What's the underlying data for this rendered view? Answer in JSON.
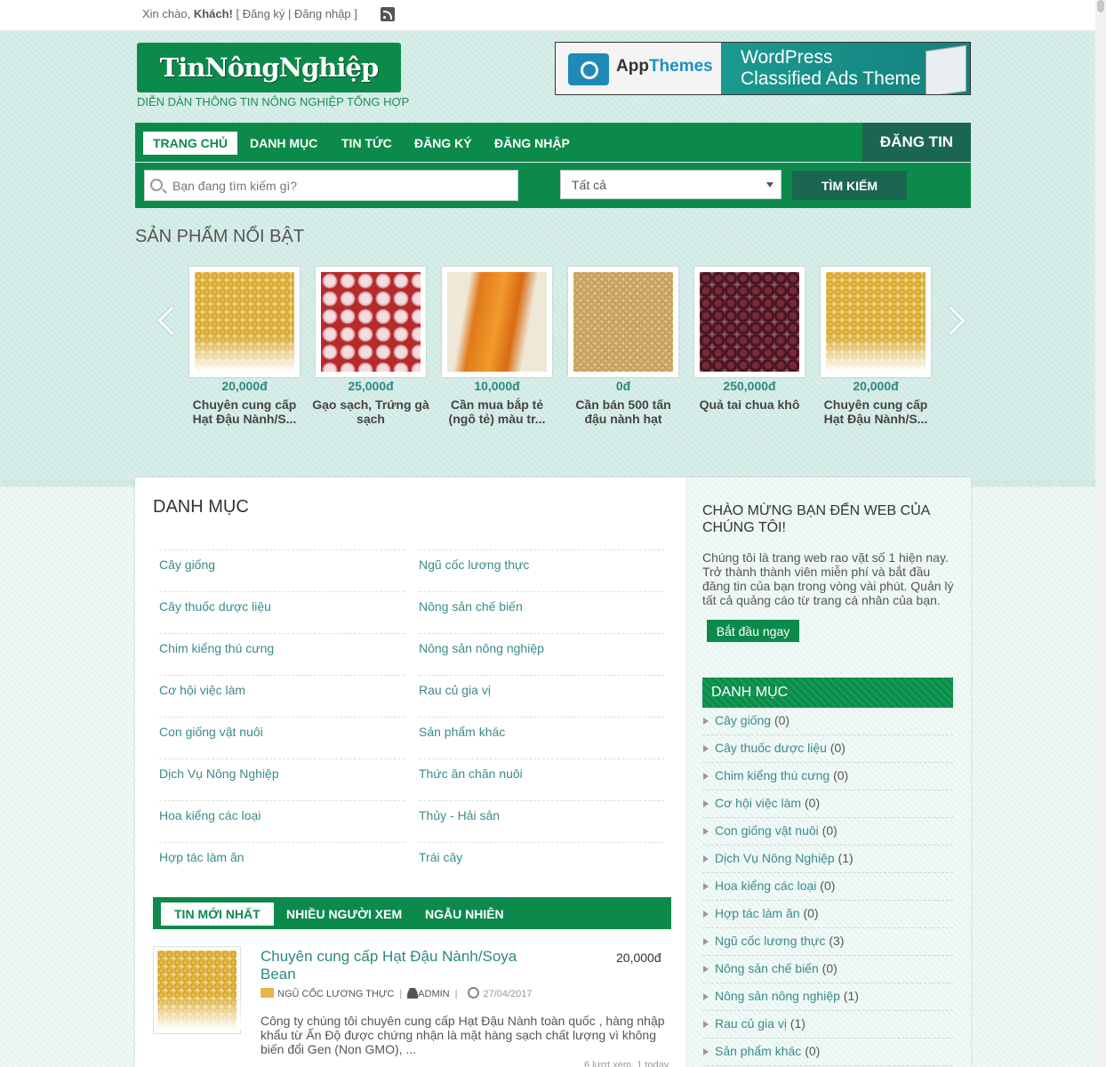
{
  "topbar": {
    "greeting": "Xin chào,",
    "user": "Khách!",
    "register": "Đăng ký",
    "login": "Đăng nhập"
  },
  "logo": {
    "text": "TinNôngNghiệp",
    "tagline": "DIỄN DÀN THÔNG TIN NÔNG NGHIỆP TỔNG HỢP"
  },
  "ad": {
    "brand_app": "App",
    "brand_themes": "Themes",
    "title_line1": "WordPress",
    "title_line2": "Classified Ads Theme"
  },
  "nav": {
    "items": [
      {
        "label": "TRANG CHỦ"
      },
      {
        "label": "DANH MỤC"
      },
      {
        "label": "TIN TỨC"
      },
      {
        "label": "ĐĂNG KÝ"
      },
      {
        "label": "ĐĂNG NHẬP"
      }
    ],
    "post_button": "ĐĂNG TIN"
  },
  "search": {
    "placeholder": "Bạn đang tìm kiếm gì?",
    "category": "Tất cả",
    "button": "TÌM KIẾM"
  },
  "featured": {
    "title": "SẢN PHẨM NỔI BẬT",
    "items": [
      {
        "price": "20,000đ",
        "name": "Chuyên cung cấp Hạt Đậu Nành/S..."
      },
      {
        "price": "25,000đ",
        "name": "Gạo sạch, Trứng gà sạch"
      },
      {
        "price": "10,000đ",
        "name": "Cần mua bắp tẻ (ngô tẻ) màu tr..."
      },
      {
        "price": "0đ",
        "name": "Cần bán 500 tấn đậu nành hạt"
      },
      {
        "price": "250,000đ",
        "name": "Quả tai chua khô"
      },
      {
        "price": "20,000đ",
        "name": "Chuyên cung cấp Hạt Đậu Nành/S..."
      }
    ]
  },
  "main": {
    "category_title": "DANH MỤC",
    "categories_left": [
      "Cây giống",
      "Cây thuốc dược liệu",
      "Chim kiểng thú cưng",
      "Cơ hội việc làm",
      "Con giống vật nuôi",
      "Dịch Vụ Nông Nghiệp",
      "Hoa kiểng các loại",
      "Hợp tác làm ăn"
    ],
    "categories_right": [
      "Ngũ cốc lương thực",
      "Nông sản chế biến",
      "Nông sản nông nghiệp",
      "Rau củ gia vị",
      "Sản phẩm khác",
      "Thức ăn chăn nuôi",
      "Thủy - Hải sản",
      "Trái cây"
    ],
    "tabs": [
      "TIN MỚI NHẤT",
      "NHIỀU NGƯỜI XEM",
      "NGẪU NHIÊN"
    ],
    "post": {
      "title": "Chuyên cung cấp Hạt Đậu Nành/Soya Bean",
      "price": "20,000đ",
      "category": "NGŨ CỐC LƯƠNG THỰC",
      "author": "ADMIN",
      "date": "27/04/2017",
      "description": "Công ty chúng tôi chuyên cung cấp Hạt Đậu Nành toàn quốc , hàng nhập khẩu từ Ấn Độ được chứng nhận là mặt hàng sạch chất lượng vì không biến đổi Gen (Non GMO), ...",
      "stats": "6 lượt xem, 1 today"
    }
  },
  "sidebar": {
    "welcome_title": "CHÀO MỪNG BẠN ĐẾN WEB CỦA CHÚNG TÔI!",
    "welcome_text": "Chúng tôi là trang web rao vặt số 1 hiện nay. Trở thành thành viên miễn phí và bắt đầu đăng tin của bạn trong vòng vài phút. Quản lý tất cả quảng cáo từ trang cá nhân của bạn.",
    "start_button": "Bắt đầu ngay",
    "category_title": "DANH MỤC",
    "items": [
      {
        "name": "Cây giống",
        "count": "(0)"
      },
      {
        "name": "Cây thuốc dược liệu",
        "count": "(0)"
      },
      {
        "name": "Chim kiểng thú cưng",
        "count": "(0)"
      },
      {
        "name": "Cơ hội việc làm",
        "count": "(0)"
      },
      {
        "name": "Con giống vật nuôi",
        "count": "(0)"
      },
      {
        "name": "Dịch Vụ Nông Nghiệp",
        "count": "(1)"
      },
      {
        "name": "Hoa kiểng các loại",
        "count": "(0)"
      },
      {
        "name": "Hợp tác làm ăn",
        "count": "(0)"
      },
      {
        "name": "Ngũ cốc lương thực",
        "count": "(3)"
      },
      {
        "name": "Nông sản chế biến",
        "count": "(0)"
      },
      {
        "name": "Nông sản nông nghiệp",
        "count": "(1)"
      },
      {
        "name": "Rau củ gia vị",
        "count": "(1)"
      },
      {
        "name": "Sản phẩm khác",
        "count": "(0)"
      }
    ]
  }
}
